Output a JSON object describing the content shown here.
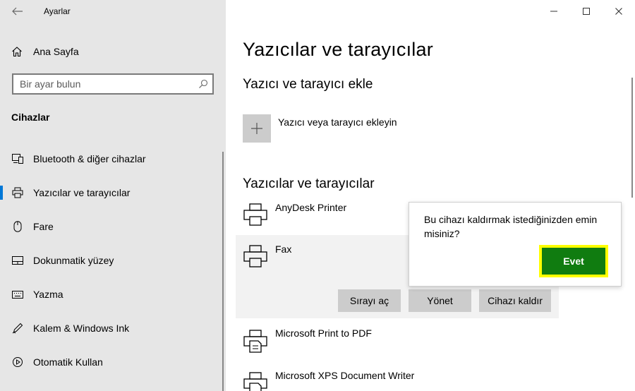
{
  "window": {
    "app_title": "Ayarlar"
  },
  "sidebar": {
    "home_label": "Ana Sayfa",
    "search_placeholder": "Bir ayar bulun",
    "section_title": "Cihazlar",
    "items": [
      {
        "label": "Bluetooth & diğer cihazlar",
        "icon": "bluetooth-devices-icon"
      },
      {
        "label": "Yazıcılar ve tarayıcılar",
        "icon": "printer-icon",
        "active": true
      },
      {
        "label": "Fare",
        "icon": "mouse-icon"
      },
      {
        "label": "Dokunmatik yüzey",
        "icon": "touchpad-icon"
      },
      {
        "label": "Yazma",
        "icon": "keyboard-icon"
      },
      {
        "label": "Kalem & Windows Ink",
        "icon": "pen-icon"
      },
      {
        "label": "Otomatik Kullan",
        "icon": "autoplay-icon"
      }
    ]
  },
  "main": {
    "title": "Yazıcılar ve tarayıcılar",
    "add_section_title": "Yazıcı ve tarayıcı ekle",
    "add_label": "Yazıcı veya tarayıcı ekleyin",
    "list_section_title": "Yazıcılar ve tarayıcılar",
    "printers": [
      {
        "name": "AnyDesk Printer"
      },
      {
        "name": "Fax",
        "selected": true
      },
      {
        "name": "Microsoft Print to PDF"
      },
      {
        "name": "Microsoft XPS Document Writer"
      }
    ],
    "actions": {
      "open_queue": "Sırayı aç",
      "manage": "Yönet",
      "remove": "Cihazı kaldır"
    }
  },
  "flyout": {
    "message": "Bu cihazı kaldırmak istediğinizden emin misiniz?",
    "confirm_label": "Evet"
  },
  "colors": {
    "accent": "#0078d7",
    "confirm_button": "#107c10",
    "highlight": "#ffff00",
    "sidebar_bg": "#e6e6e6"
  }
}
